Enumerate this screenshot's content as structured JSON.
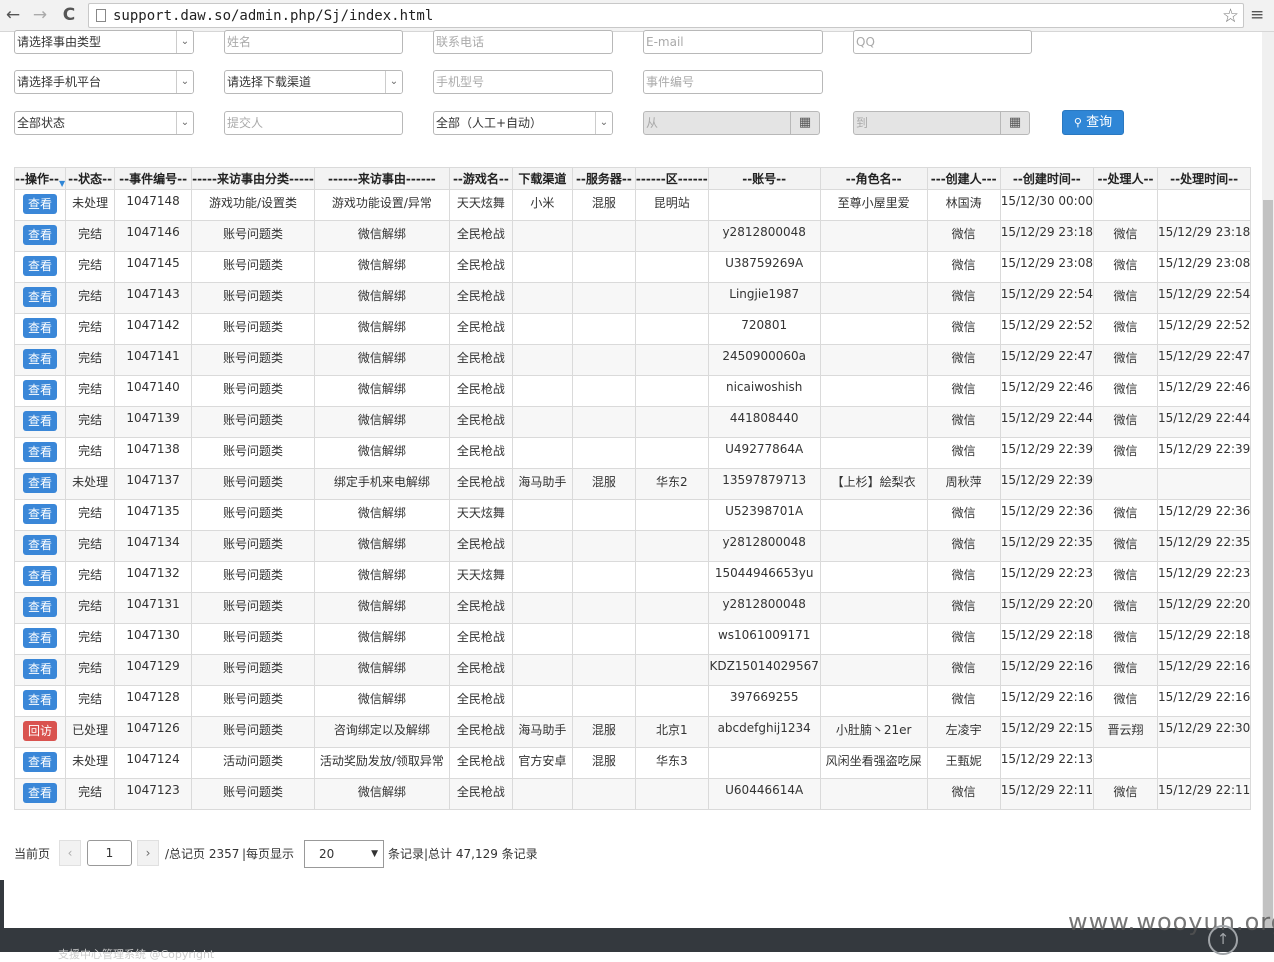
{
  "browser": {
    "url": "support.daw.so/admin.php/Sj/index.html",
    "back_icon": "←",
    "forward_icon": "→",
    "reload_icon": "C",
    "star_icon": "☆",
    "menu_icon": "≡"
  },
  "filters": {
    "event_type": "请选择事由类型",
    "name_placeholder": "姓名",
    "phone_placeholder": "联系电话",
    "email_placeholder": "E-mail",
    "qq_placeholder": "QQ",
    "platform": "请选择手机平台",
    "channel": "请选择下载渠道",
    "model_placeholder": "手机型号",
    "event_no_placeholder": "事件编号",
    "status": "全部状态",
    "submitter_placeholder": "提交人",
    "mode": "全部（人工+自动）",
    "from_placeholder": "从",
    "to_placeholder": "到",
    "query_label": "查询",
    "calendar_icon": "▦",
    "search_icon": "🔍"
  },
  "table": {
    "headers": [
      "--操作--",
      "--状态--",
      "--事件编号--",
      "-----来访事由分类-----",
      "------来访事由------",
      "--游戏名--",
      "下载渠道",
      "--服务器--",
      "------区------",
      "--账号--",
      "--角色名--",
      "---创建人---",
      "--创建时间--",
      "--处理人--",
      "--处理时间--"
    ],
    "rows": [
      {
        "action": "查看",
        "status": "未处理",
        "id": "1047148",
        "category": "游戏功能/设置类",
        "reason": "游戏功能设置/异常",
        "game": "天天炫舞",
        "channel": "小米",
        "server": "混服",
        "zone": "昆明站",
        "account": "",
        "role": "至尊小屋里爱",
        "creator": "林国涛",
        "created": "15/12/30 00:00",
        "handler": "",
        "handled": ""
      },
      {
        "action": "查看",
        "status": "完结",
        "id": "1047146",
        "category": "账号问题类",
        "reason": "微信解绑",
        "game": "全民枪战",
        "channel": "",
        "server": "",
        "zone": "",
        "account": "y2812800048",
        "role": "",
        "creator": "微信",
        "created": "15/12/29 23:18",
        "handler": "微信",
        "handled": "15/12/29 23:18"
      },
      {
        "action": "查看",
        "status": "完结",
        "id": "1047145",
        "category": "账号问题类",
        "reason": "微信解绑",
        "game": "全民枪战",
        "channel": "",
        "server": "",
        "zone": "",
        "account": "U38759269A",
        "role": "",
        "creator": "微信",
        "created": "15/12/29 23:08",
        "handler": "微信",
        "handled": "15/12/29 23:08"
      },
      {
        "action": "查看",
        "status": "完结",
        "id": "1047143",
        "category": "账号问题类",
        "reason": "微信解绑",
        "game": "全民枪战",
        "channel": "",
        "server": "",
        "zone": "",
        "account": "Lingjie1987",
        "role": "",
        "creator": "微信",
        "created": "15/12/29 22:54",
        "handler": "微信",
        "handled": "15/12/29 22:54"
      },
      {
        "action": "查看",
        "status": "完结",
        "id": "1047142",
        "category": "账号问题类",
        "reason": "微信解绑",
        "game": "全民枪战",
        "channel": "",
        "server": "",
        "zone": "",
        "account": "720801",
        "role": "",
        "creator": "微信",
        "created": "15/12/29 22:52",
        "handler": "微信",
        "handled": "15/12/29 22:52"
      },
      {
        "action": "查看",
        "status": "完结",
        "id": "1047141",
        "category": "账号问题类",
        "reason": "微信解绑",
        "game": "全民枪战",
        "channel": "",
        "server": "",
        "zone": "",
        "account": "2450900060a",
        "role": "",
        "creator": "微信",
        "created": "15/12/29 22:47",
        "handler": "微信",
        "handled": "15/12/29 22:47"
      },
      {
        "action": "查看",
        "status": "完结",
        "id": "1047140",
        "category": "账号问题类",
        "reason": "微信解绑",
        "game": "全民枪战",
        "channel": "",
        "server": "",
        "zone": "",
        "account": "nicaiwoshish",
        "role": "",
        "creator": "微信",
        "created": "15/12/29 22:46",
        "handler": "微信",
        "handled": "15/12/29 22:46"
      },
      {
        "action": "查看",
        "status": "完结",
        "id": "1047139",
        "category": "账号问题类",
        "reason": "微信解绑",
        "game": "全民枪战",
        "channel": "",
        "server": "",
        "zone": "",
        "account": "441808440",
        "role": "",
        "creator": "微信",
        "created": "15/12/29 22:44",
        "handler": "微信",
        "handled": "15/12/29 22:44"
      },
      {
        "action": "查看",
        "status": "完结",
        "id": "1047138",
        "category": "账号问题类",
        "reason": "微信解绑",
        "game": "全民枪战",
        "channel": "",
        "server": "",
        "zone": "",
        "account": "U49277864A",
        "role": "",
        "creator": "微信",
        "created": "15/12/29 22:39",
        "handler": "微信",
        "handled": "15/12/29 22:39"
      },
      {
        "action": "查看",
        "status": "未处理",
        "id": "1047137",
        "category": "账号问题类",
        "reason": "绑定手机来电解绑",
        "game": "全民枪战",
        "channel": "海马助手",
        "server": "混服",
        "zone": "华东2",
        "account": "13597879713",
        "role": "【上杉】絵梨衣",
        "creator": "周秋萍",
        "created": "15/12/29 22:39",
        "handler": "",
        "handled": ""
      },
      {
        "action": "查看",
        "status": "完结",
        "id": "1047135",
        "category": "账号问题类",
        "reason": "微信解绑",
        "game": "天天炫舞",
        "channel": "",
        "server": "",
        "zone": "",
        "account": "U52398701A",
        "role": "",
        "creator": "微信",
        "created": "15/12/29 22:36",
        "handler": "微信",
        "handled": "15/12/29 22:36"
      },
      {
        "action": "查看",
        "status": "完结",
        "id": "1047134",
        "category": "账号问题类",
        "reason": "微信解绑",
        "game": "全民枪战",
        "channel": "",
        "server": "",
        "zone": "",
        "account": "y2812800048",
        "role": "",
        "creator": "微信",
        "created": "15/12/29 22:35",
        "handler": "微信",
        "handled": "15/12/29 22:35"
      },
      {
        "action": "查看",
        "status": "完结",
        "id": "1047132",
        "category": "账号问题类",
        "reason": "微信解绑",
        "game": "天天炫舞",
        "channel": "",
        "server": "",
        "zone": "",
        "account": "15044946653yu",
        "role": "",
        "creator": "微信",
        "created": "15/12/29 22:23",
        "handler": "微信",
        "handled": "15/12/29 22:23"
      },
      {
        "action": "查看",
        "status": "完结",
        "id": "1047131",
        "category": "账号问题类",
        "reason": "微信解绑",
        "game": "全民枪战",
        "channel": "",
        "server": "",
        "zone": "",
        "account": "y2812800048",
        "role": "",
        "creator": "微信",
        "created": "15/12/29 22:20",
        "handler": "微信",
        "handled": "15/12/29 22:20"
      },
      {
        "action": "查看",
        "status": "完结",
        "id": "1047130",
        "category": "账号问题类",
        "reason": "微信解绑",
        "game": "全民枪战",
        "channel": "",
        "server": "",
        "zone": "",
        "account": "ws1061009171",
        "role": "",
        "creator": "微信",
        "created": "15/12/29 22:18",
        "handler": "微信",
        "handled": "15/12/29 22:18"
      },
      {
        "action": "查看",
        "status": "完结",
        "id": "1047129",
        "category": "账号问题类",
        "reason": "微信解绑",
        "game": "全民枪战",
        "channel": "",
        "server": "",
        "zone": "",
        "account": "KDZ15014029567",
        "role": "",
        "creator": "微信",
        "created": "15/12/29 22:16",
        "handler": "微信",
        "handled": "15/12/29 22:16"
      },
      {
        "action": "查看",
        "status": "完结",
        "id": "1047128",
        "category": "账号问题类",
        "reason": "微信解绑",
        "game": "全民枪战",
        "channel": "",
        "server": "",
        "zone": "",
        "account": "397669255",
        "role": "",
        "creator": "微信",
        "created": "15/12/29 22:16",
        "handler": "微信",
        "handled": "15/12/29 22:16"
      },
      {
        "action": "回访",
        "status": "已处理",
        "id": "1047126",
        "category": "账号问题类",
        "reason": "咨询绑定以及解绑",
        "game": "全民枪战",
        "channel": "海马助手",
        "server": "混服",
        "zone": "北京1",
        "account": "abcdefghij1234",
        "role": "小肚腩丶21er",
        "creator": "左凌宇",
        "created": "15/12/29 22:15",
        "handler": "晋云翔",
        "handled": "15/12/29 22:30"
      },
      {
        "action": "查看",
        "status": "未处理",
        "id": "1047124",
        "category": "活动问题类",
        "reason": "活动奖励发放/领取异常",
        "game": "全民枪战",
        "channel": "官方安卓",
        "server": "混服",
        "zone": "华东3",
        "account": "",
        "role": "风闲坐看强盗吃屎",
        "creator": "王甄妮",
        "created": "15/12/29 22:13",
        "handler": "",
        "handled": ""
      },
      {
        "action": "查看",
        "status": "完结",
        "id": "1047123",
        "category": "账号问题类",
        "reason": "微信解绑",
        "game": "全民枪战",
        "channel": "",
        "server": "",
        "zone": "",
        "account": "U60446614A",
        "role": "",
        "creator": "微信",
        "created": "15/12/29 22:11",
        "handler": "微信",
        "handled": "15/12/29 22:11"
      }
    ]
  },
  "pager": {
    "current_label": "当前页",
    "prev_icon": "‹",
    "page": "1",
    "next_icon": "›",
    "total_pages": "/总记页 2357",
    "per_page_label": "|每页显示",
    "per_page": "20",
    "dropdown_icon": "▼",
    "records_label": "条记录|总计 47,129 条记录"
  },
  "footer": {
    "text": "支援中心管理系统 @Copyright",
    "to_top_icon": "↑",
    "watermark": "www.wooyun.org"
  },
  "colors": {
    "primary": "#2f86d6",
    "danger": "#d9534f",
    "footer": "#34393e"
  }
}
